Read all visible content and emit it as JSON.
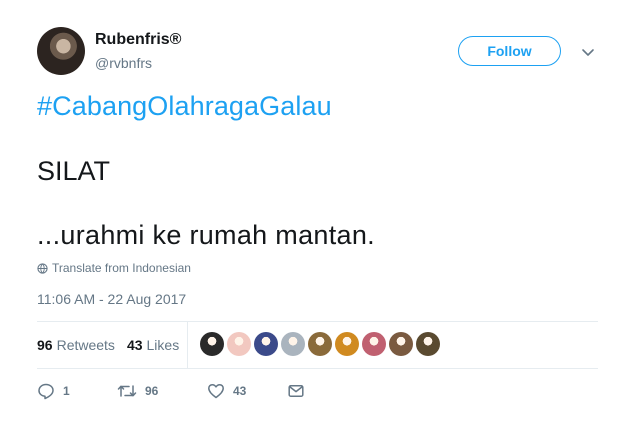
{
  "user": {
    "display_name": "Rubenfris®",
    "handle": "@rvbnfrs",
    "follow_label": "Follow"
  },
  "tweet": {
    "hashtag": "#CabangOlahragaGalau",
    "line1": "SILAT",
    "line2": "...urahmi ke rumah mantan.",
    "translate_label": "Translate from Indonesian",
    "timestamp": "11:06 AM - 22 Aug 2017"
  },
  "stats": {
    "retweets_count": "96",
    "retweets_label": "Retweets",
    "likes_count": "43",
    "likes_label": "Likes"
  },
  "likers": [
    "#2a2a2a",
    "#f2c8c0",
    "#3b4a8a",
    "#aab4be",
    "#8a6a3a",
    "#d08a20",
    "#c06070",
    "#7a5a40",
    "#5a4a30"
  ],
  "actions": {
    "reply_count": "1",
    "retweet_count": "96",
    "like_count": "43"
  },
  "colors": {
    "accent": "#1da1f2",
    "muted": "#657786",
    "text": "#14171a"
  }
}
